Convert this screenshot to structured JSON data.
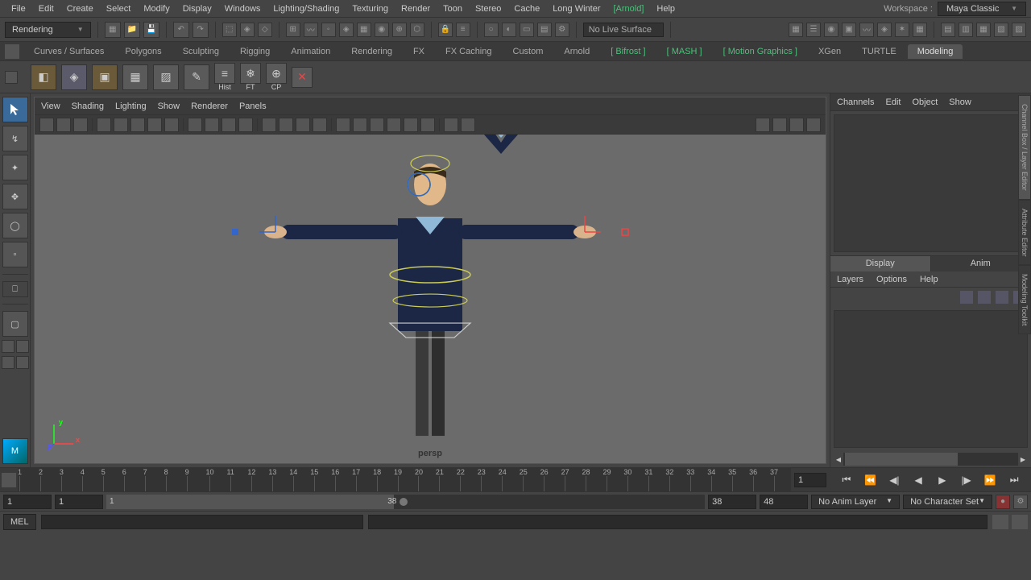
{
  "menubar": [
    "File",
    "Edit",
    "Create",
    "Select",
    "Modify",
    "Display",
    "Windows",
    "Lighting/Shading",
    "Texturing",
    "Render",
    "Toon",
    "Stereo",
    "Cache",
    "Long Winter",
    "Arnold",
    "Help"
  ],
  "workspace": {
    "label": "Workspace :",
    "value": "Maya Classic"
  },
  "moduleDrop": "Rendering",
  "liveSurface": "No Live Surface",
  "shelfTabs": [
    {
      "l": "Curves / Surfaces"
    },
    {
      "l": "Polygons"
    },
    {
      "l": "Sculpting"
    },
    {
      "l": "Rigging"
    },
    {
      "l": "Animation"
    },
    {
      "l": "Rendering"
    },
    {
      "l": "FX"
    },
    {
      "l": "FX Caching"
    },
    {
      "l": "Custom"
    },
    {
      "l": "Arnold"
    },
    {
      "l": "Bifrost",
      "b": true
    },
    {
      "l": "MASH",
      "b": true
    },
    {
      "l": "Motion Graphics",
      "b": true
    },
    {
      "l": "XGen"
    },
    {
      "l": "TURTLE"
    },
    {
      "l": "Modeling",
      "active": true
    }
  ],
  "shelfLabels": [
    "Hist",
    "FT",
    "CP"
  ],
  "viewportMenu": [
    "View",
    "Shading",
    "Lighting",
    "Show",
    "Renderer",
    "Panels"
  ],
  "perspLabel": "persp",
  "channelBoxMenu": [
    "Channels",
    "Edit",
    "Object",
    "Show"
  ],
  "layerTabs": [
    "Display",
    "Anim"
  ],
  "layerOpts": [
    "Layers",
    "Options",
    "Help"
  ],
  "rightTabs": [
    "Channel Box / Layer Editor",
    "Attribute Editor",
    "Modeling Toolkit"
  ],
  "timeline": {
    "start": 1,
    "end": 38,
    "curField": "1"
  },
  "range": {
    "start": "1",
    "min": "1",
    "sliderStart": "1",
    "sliderEnd": "38",
    "max": "38",
    "end": "48"
  },
  "animLayer": "No Anim Layer",
  "charSet": "No Character Set",
  "cmd": "MEL",
  "axes": {
    "x": "x",
    "y": "y",
    "z": "z"
  }
}
